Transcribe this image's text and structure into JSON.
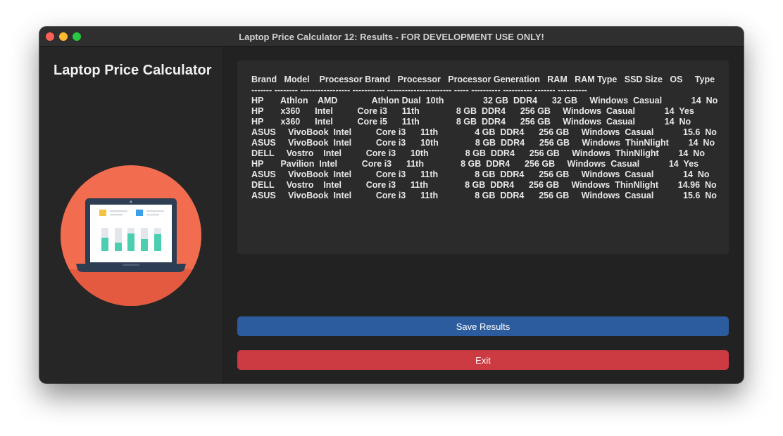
{
  "window": {
    "title": "Laptop Price Calculator 12: Results - FOR DEVELOPMENT USE ONLY!"
  },
  "sidebar": {
    "app_name": "Laptop Price Calculator",
    "logo_icon": "laptop-chart-icon"
  },
  "results": {
    "header": "Brand   Model    Processor Brand   Processor   Processor Generation   RAM   RAM Type   SSD Size   OS     Type",
    "separator": "------- -------- ----------------- ----------- ---------------------- ----- ---------- ---------- ------- ----------",
    "rows": [
      "HP       Athlon    AMD              Athlon Dual  10th                32 GB  DDR4      32 GB     Windows  Casual            14  No",
      "HP       x360      Intel          Core i3      11th               8 GB  DDR4      256 GB     Windows  Casual            14  Yes",
      "HP       x360      Intel          Core i5      11th               8 GB  DDR4      256 GB     Windows  Casual            14  No",
      "ASUS     VivoBook  Intel          Core i3      11th               4 GB  DDR4      256 GB     Windows  Casual            15.6  No",
      "ASUS     VivoBook  Intel          Core i3      10th               8 GB  DDR4      256 GB     Windows  ThinNlight        14  No",
      "DELL     Vostro    Intel          Core i3      10th               8 GB  DDR4      256 GB     Windows  ThinNlight        14  No",
      "HP       Pavilion  Intel          Core i3      11th               8 GB  DDR4      256 GB     Windows  Casual            14  Yes",
      "ASUS     VivoBook  Intel          Core i3      11th               8 GB  DDR4      256 GB     Windows  Casual            14  No",
      "DELL     Vostro    Intel          Core i3      11th               8 GB  DDR4      256 GB     Windows  ThinNlight        14.96  No",
      "ASUS     VivoBook  Intel          Core i3      11th               8 GB  DDR4      256 GB     Windows  Casual            15.6  No"
    ]
  },
  "buttons": {
    "save_label": "Save Results",
    "exit_label": "Exit"
  },
  "colors": {
    "save": "#2d5c9e",
    "exit": "#cc3a42",
    "logo_circle": "#f26d50"
  }
}
